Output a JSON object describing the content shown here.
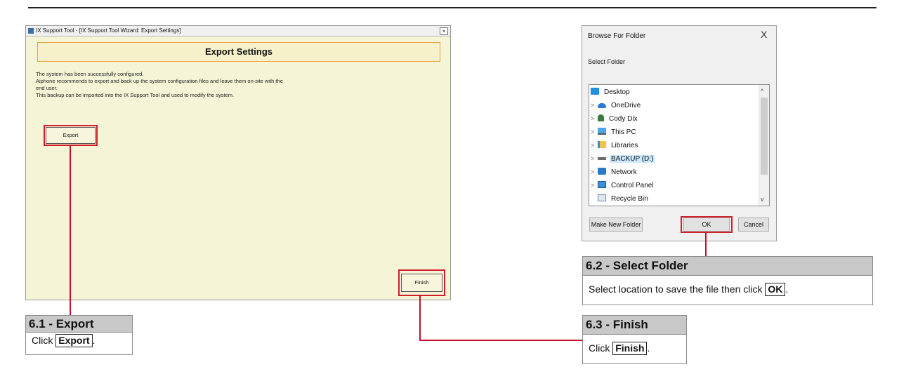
{
  "wizard": {
    "title": "IX Support Tool - [IX Support Tool Wizard: Export Settings]",
    "close_glyph": "×",
    "header": "Export Settings",
    "description": [
      "The system has been successfully configured.",
      "Aiphone recommends to export and back up the system configuration files and leave them on-site with the",
      "end user.",
      "This backup can be imported into the IX Support Tool and used to modify the system."
    ],
    "export_label": "Export",
    "finish_label": "Finish",
    "background_color": "#f5f4d6"
  },
  "dialog": {
    "title": "Browse For Folder",
    "close_glyph": "X",
    "instruction": "Select Folder",
    "tree": [
      {
        "label": "Desktop",
        "icon": "desktop-icon",
        "expandable": false
      },
      {
        "label": "OneDrive",
        "icon": "cloud-icon",
        "expandable": true
      },
      {
        "label": "Cody Dix",
        "icon": "user-icon",
        "expandable": true
      },
      {
        "label": "This PC",
        "icon": "computer-icon",
        "expandable": true
      },
      {
        "label": "Libraries",
        "icon": "library-icon",
        "expandable": true
      },
      {
        "label": "BACKUP (D:)",
        "icon": "drive-icon",
        "expandable": true,
        "selected": true
      },
      {
        "label": "Network",
        "icon": "network-icon",
        "expandable": true
      },
      {
        "label": "Control Panel",
        "icon": "control-panel-icon",
        "expandable": true
      },
      {
        "label": "Recycle Bin",
        "icon": "recycle-bin-icon",
        "expandable": false
      }
    ],
    "make_new_folder_label": "Make New Folder",
    "ok_label": "OK",
    "cancel_label": "Cancel"
  },
  "callouts": {
    "export": {
      "title": "6.1 - Export",
      "body_prefix": "Click",
      "key": "Export",
      "body_suffix": "."
    },
    "select_folder": {
      "title": "6.2 - Select Folder",
      "body_prefix": "Select location to save the file then click",
      "key": "OK",
      "body_suffix": "."
    },
    "finish": {
      "title": "6.3 - Finish",
      "body_prefix": "Click",
      "key": "Finish",
      "body_suffix": "."
    }
  },
  "colors": {
    "highlight": "#d0202c",
    "connector": "#c8102e",
    "callout_header": "#c8c8c8",
    "header_border": "#e9a23a"
  }
}
